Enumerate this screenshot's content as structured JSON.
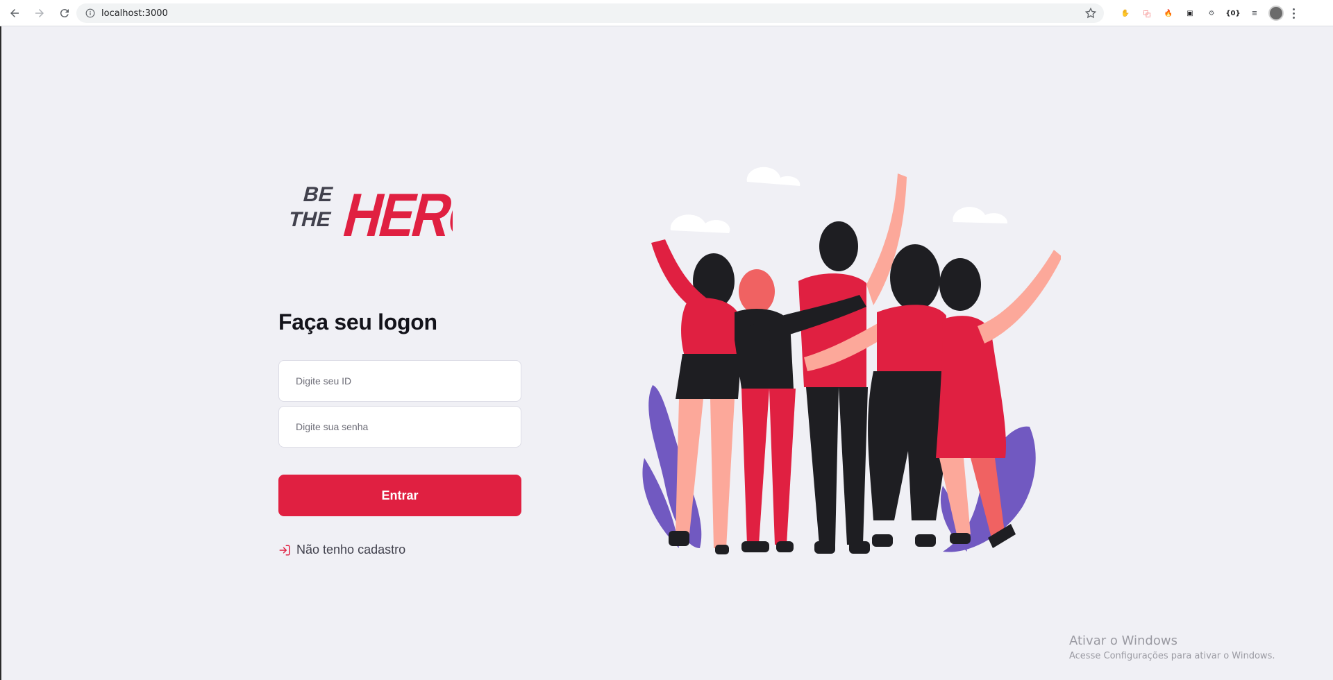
{
  "browser": {
    "url": "localhost:3000",
    "colors": {
      "toolbar": "#FFFFFF",
      "omnibox": "#F1F3F4",
      "icon": "#5F6368"
    },
    "extensions": [
      {
        "name": "ublock-icon",
        "color": "#E02041",
        "glyph": "✋"
      },
      {
        "name": "translate-icon",
        "color": "#F06262",
        "glyph": "⿻"
      },
      {
        "name": "fire-extension-icon",
        "color": "#E43B2B",
        "glyph": "🔥"
      },
      {
        "name": "extension-box-icon",
        "color": "#202124",
        "glyph": "▣"
      },
      {
        "name": "settings-extension-icon",
        "color": "#5F6368",
        "glyph": "⚙"
      },
      {
        "name": "json-viewer-icon",
        "color": "#202124",
        "glyph": "{0}"
      },
      {
        "name": "reading-list-icon",
        "color": "#5F6368",
        "glyph": "≡"
      }
    ]
  },
  "logo": {
    "be": "BE",
    "the": "THE",
    "hero": "HERO",
    "colors": {
      "dark": "#41414D",
      "accent": "#E02041"
    }
  },
  "login": {
    "title": "Faça seu logon",
    "id_placeholder": "Digite seu ID",
    "password_placeholder": "Digite sua senha",
    "submit_label": "Entrar",
    "register_label": "Não tenho cadastro"
  },
  "colors": {
    "background": "#F0F0F5",
    "primary": "#E02041",
    "text_dark": "#13131A",
    "text_muted": "#41414D",
    "plant": "#7159C1"
  },
  "watermark": {
    "line1": "Ativar o Windows",
    "line2": "Acesse Configurações para ativar o Windows."
  }
}
